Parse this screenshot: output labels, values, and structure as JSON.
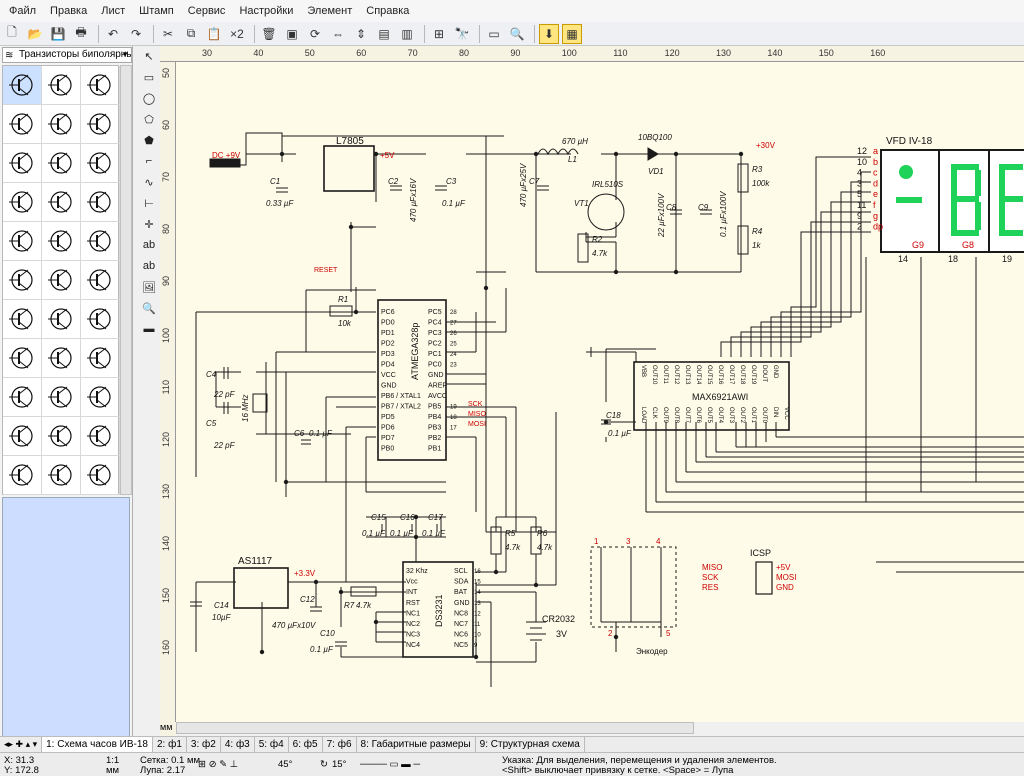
{
  "menu": [
    "Файл",
    "Правка",
    "Лист",
    "Штамп",
    "Сервис",
    "Настройки",
    "Элемент",
    "Справка"
  ],
  "library": {
    "selected": "Транзисторы биполярные"
  },
  "ruler": {
    "top": [
      "30",
      "40",
      "50",
      "60",
      "70",
      "80",
      "90",
      "100",
      "110",
      "120",
      "130",
      "140",
      "150",
      "160"
    ],
    "left": [
      "50",
      "60",
      "70",
      "80",
      "90",
      "100",
      "110",
      "120",
      "130",
      "140",
      "150",
      "160"
    ],
    "unit": "мм"
  },
  "schematic": {
    "dc_in": "DC +9V",
    "l7805": "L7805",
    "plus5v": "+5V",
    "plus30v": "+30V",
    "plus33v": "+3.3V",
    "c1_name": "C1",
    "c1_val": "0.33 µF",
    "c2_name": "C2",
    "c2_val": "470 µFx16V",
    "c3_name": "C3",
    "c3_val": "0.1 µF",
    "c4_name": "C4",
    "c4_val": "22 pF",
    "c5_name": "C5",
    "c5_val": "22 pF",
    "c6_name": "C6",
    "c6_val": "0.1 µF",
    "c7_name": "C7",
    "c7_val": "470 µFx25V",
    "c8_name": "C8",
    "c8_val": "22 µFx100V",
    "c9_name": "C9",
    "c9_val": "0.1 µFx100V",
    "c10_name": "C10",
    "c10_val": "0.1 µF",
    "c12_name": "C12",
    "c12_val": "470 µFx10V",
    "c14_name": "C14",
    "c14_val": "10µF",
    "c15_name": "C15",
    "c15_val": "0.1 µF",
    "c16_name": "C16",
    "c16_val": "0.1 µF",
    "c17_name": "C17",
    "c17_val": "0.1 µF",
    "c18_name": "C18",
    "c18_val": "0.1 µF",
    "l1_val": "670 µH",
    "l1_name": "L1",
    "d_name": "10BQ100",
    "vd1": "VD1",
    "r1_name": "R1",
    "r1_val": "10k",
    "r2_name": "R2",
    "r2_val": "4.7k",
    "r3_name": "R3",
    "r3_val": "100k",
    "r4_name": "R4",
    "r4_val": "1k",
    "r5_name": "R5",
    "r5_val": "4.7k",
    "r6_name": "R6",
    "r6_val": "4.7k",
    "r7_name": "R7",
    "r7_val": "4.7k",
    "fet": "IRL510S",
    "vt1": "VT1",
    "xtal": "16 MHz",
    "reset": "RESET",
    "mcu": "ATMEGA328p",
    "mcu_left": [
      "PC6",
      "PD0",
      "PD1",
      "PD2",
      "PD3",
      "PD4",
      "VCC",
      "GND",
      "PB6 / XTAL1",
      "PB7 / XTAL2",
      "PD5",
      "PD6",
      "PD7",
      "PB0"
    ],
    "mcu_right": [
      "PC5",
      "PC4",
      "PC3",
      "PC2",
      "PC1",
      "PC0",
      "GND",
      "AREF",
      "AVCC",
      "PB5",
      "PB4",
      "PB3",
      "PB2",
      "PB1"
    ],
    "mcu_pins_right": [
      "28",
      "27",
      "26",
      "25",
      "24",
      "23",
      "",
      "",
      "",
      "19",
      "18",
      "17"
    ],
    "sck": "SCK",
    "miso": "MISO",
    "mosi": "MOSI",
    "max": "MAX6921AWI",
    "max_top": [
      "VBB",
      "OUT10",
      "OUT11",
      "OUT12",
      "OUT13",
      "OUT14",
      "OUT15",
      "OUT16",
      "OUT17",
      "OUT18",
      "OUT19",
      "DOUT",
      "GND"
    ],
    "max_bot": [
      "LOAD",
      "CLK",
      "OUT9",
      "OUT8",
      "OUT7",
      "OUT6",
      "OUT5",
      "OUT4",
      "OUT3",
      "OUT2",
      "OUT1",
      "OUT0",
      "DIN",
      "VCC"
    ],
    "as1117": "AS1117",
    "ds_name": "DS3231",
    "ds_left": [
      "32 Khz",
      "Vcc",
      "INT",
      "RST",
      "NC1",
      "NC2",
      "NC3",
      "NC4"
    ],
    "ds_right": [
      "SCL",
      "SDA",
      "BAT",
      "GND",
      "NC8",
      "NC7",
      "NC6",
      "NC5"
    ],
    "ds_pins_right": [
      "16",
      "15",
      "14",
      "13",
      "12",
      "11",
      "10",
      "9"
    ],
    "battery": "CR2032",
    "battery_v": "3V",
    "encoder": "Энкодер",
    "enc_pins": [
      "1",
      "3",
      "4",
      "2",
      "5"
    ],
    "icsp": "ICSP",
    "icsp_left": [
      "MISO",
      "SCK",
      "RES"
    ],
    "icsp_right": [
      "+5V",
      "MOSI",
      "GND"
    ],
    "vfd": "VFD IV-18",
    "vfd_pins": [
      "12",
      "10",
      "4",
      "3",
      "5",
      "11",
      "9",
      "2"
    ],
    "vfd_seg": [
      "a",
      "b",
      "c",
      "d",
      "e",
      "f",
      "g",
      "dp"
    ],
    "vfd_grid": [
      "G9",
      "G8"
    ],
    "vfd_bottom": [
      "14",
      "18",
      "19"
    ]
  },
  "tabs": [
    "1: Схема часов ИВ-18",
    "2: ф1",
    "3: ф2",
    "4: ф3",
    "5: ф4",
    "6: ф5",
    "7: ф6",
    "8: Габаритные размеры",
    "9: Структурная схема"
  ],
  "status": {
    "x": "X: 31.3",
    "y": "Y: 172.8",
    "scale1": "1:1",
    "scale_unit": "мм",
    "grid": "Сетка: 0.1 мм",
    "zoom": "Лупа: 2.17",
    "angle1": "45°",
    "angle2": "15°",
    "hint1": "Указка: Для выделения, перемещения и удаления элементов.",
    "hint2": "<Shift> выключает привязку к сетке. <Space> = Лупа"
  },
  "colors": {
    "wire": "#1a1a1a",
    "red": "#cc0000",
    "vfd_green": "#1fd35a",
    "canvas": "#fefbe8"
  }
}
